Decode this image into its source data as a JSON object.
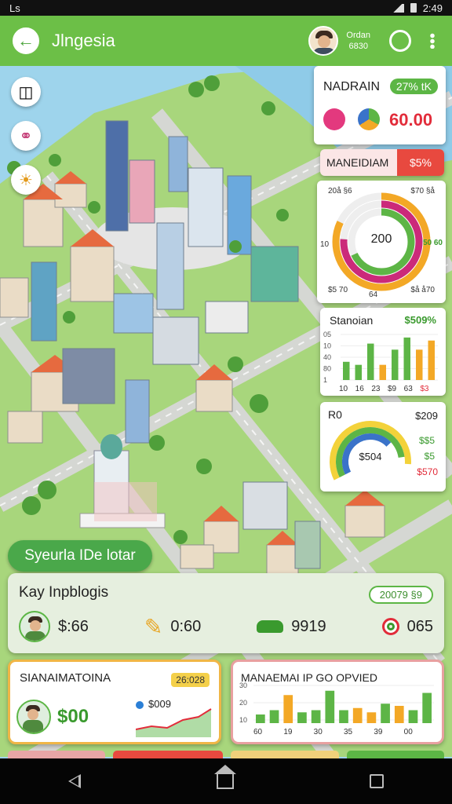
{
  "status_bar": {
    "left": "Ls",
    "time": "2:49"
  },
  "app_bar": {
    "title": "Jlngesia",
    "user_line1": "Ordan",
    "user_line2": "6830"
  },
  "top_panel": {
    "title": "NADRAIN",
    "badge": "27% tK",
    "value": "60.00"
  },
  "alert_panel": {
    "title": "MANEIDIAM",
    "value": "$5%",
    "color": "#e8493f"
  },
  "donut_panel": {
    "center": "200",
    "tl": "20å §6",
    "tr": "$70 §å",
    "left": "10",
    "right": "50 60",
    "bl": "$5 70",
    "bm": "64",
    "br": "$å å70",
    "rings": [
      {
        "pct": 0.82,
        "color": "#f3a826"
      },
      {
        "pct": 0.76,
        "color": "#cb2a7a"
      },
      {
        "pct": 0.68,
        "color": "#5db546"
      }
    ]
  },
  "bar_panel": {
    "title": "Stanoian",
    "badge": "$509%",
    "y_ticks": [
      "05",
      "10",
      "40",
      "80",
      "1"
    ],
    "x_labels": [
      "10",
      "16",
      "23",
      "$9",
      "63",
      "$3"
    ],
    "values": [
      12,
      10,
      24,
      10,
      20,
      28,
      20,
      26
    ],
    "colors": [
      "#5db546",
      "#5db546",
      "#5db546",
      "#f3a826",
      "#5db546",
      "#5db546",
      "#f3a826",
      "#f3a826"
    ]
  },
  "gauge_panel": {
    "title": "R0",
    "amount": "$209",
    "center": "$504",
    "row2": "$$5",
    "row3": "$5",
    "row4": "$570"
  },
  "section_label": "Syeurla IDe lotar",
  "key_panel": {
    "title": "Kay Inpblogis",
    "badge": "20079 §9",
    "items": [
      {
        "icon": "avatar",
        "value": "$:66"
      },
      {
        "icon": "pencil",
        "value": "0:60"
      },
      {
        "icon": "car",
        "value": "9919"
      },
      {
        "icon": "target",
        "value": "065"
      }
    ]
  },
  "card_left": {
    "title": "SIANAIMATOINA",
    "badge": "26:028",
    "value": "$00",
    "sub": "$009"
  },
  "card_right": {
    "title": "MANAEMAI IP GO OPVIED",
    "y_ticks": [
      "30",
      "20",
      "10"
    ],
    "x_labels": [
      "60",
      "19",
      "30",
      "35",
      "39",
      "00"
    ],
    "values": [
      8,
      12,
      26,
      10,
      12,
      30,
      12,
      14,
      10,
      18,
      16,
      12,
      28
    ],
    "colors": [
      "#5db546",
      "#5db546",
      "#f3a826",
      "#5db546",
      "#5db546",
      "#5db546",
      "#5db546",
      "#f3a826",
      "#f3a826",
      "#5db546",
      "#f3a826",
      "#5db546",
      "#5db546"
    ]
  }
}
